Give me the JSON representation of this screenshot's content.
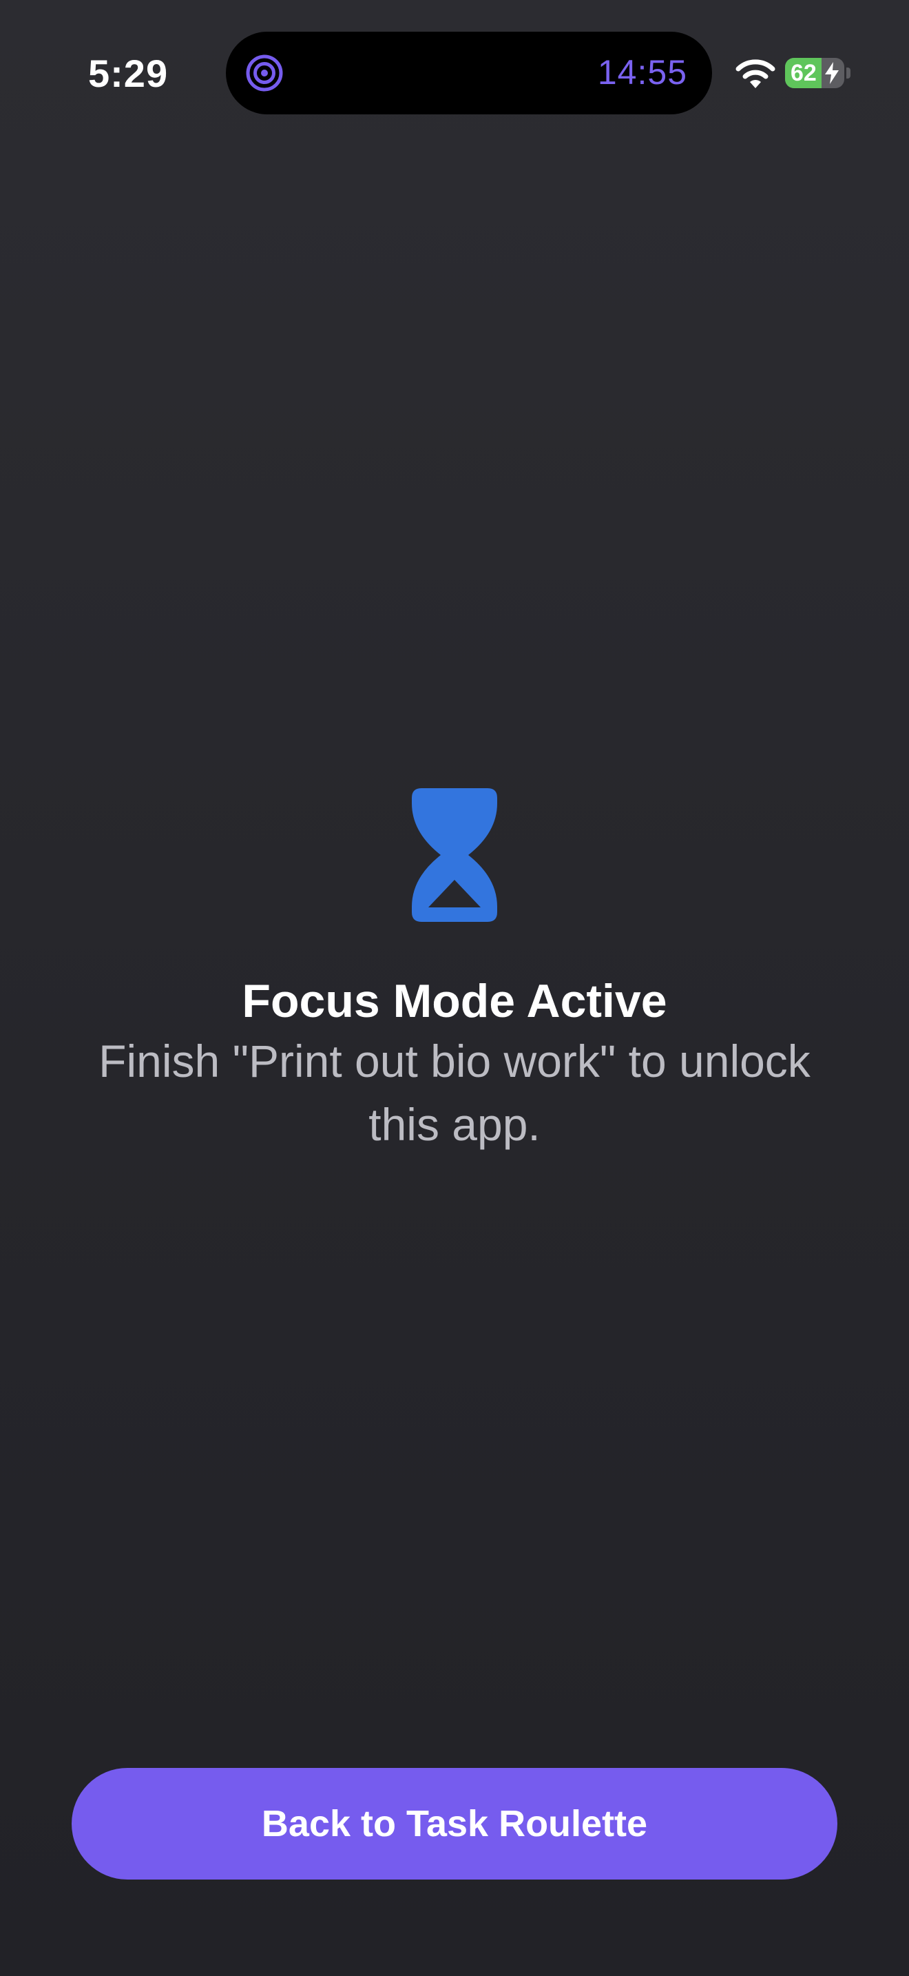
{
  "status_bar": {
    "time": "5:29",
    "activity_timer": "14:55",
    "battery_percent": 62,
    "battery_label": "62",
    "charging": true,
    "icons": {
      "activity": "concentric-target-icon",
      "wifi": "wifi-icon",
      "battery": "battery-icon",
      "charging": "lightning-bolt-icon"
    }
  },
  "focus": {
    "icon": "hourglass-icon",
    "title": "Focus Mode Active",
    "message": "Finish \"Print out bio work\" to unlock this app."
  },
  "actions": {
    "back_label": "Back to Task Roulette"
  },
  "colors": {
    "accent": "#765cee",
    "timer": "#7a62f0",
    "hourglass": "#3375de",
    "battery_green": "#5fc55b",
    "background": "#27272c"
  }
}
